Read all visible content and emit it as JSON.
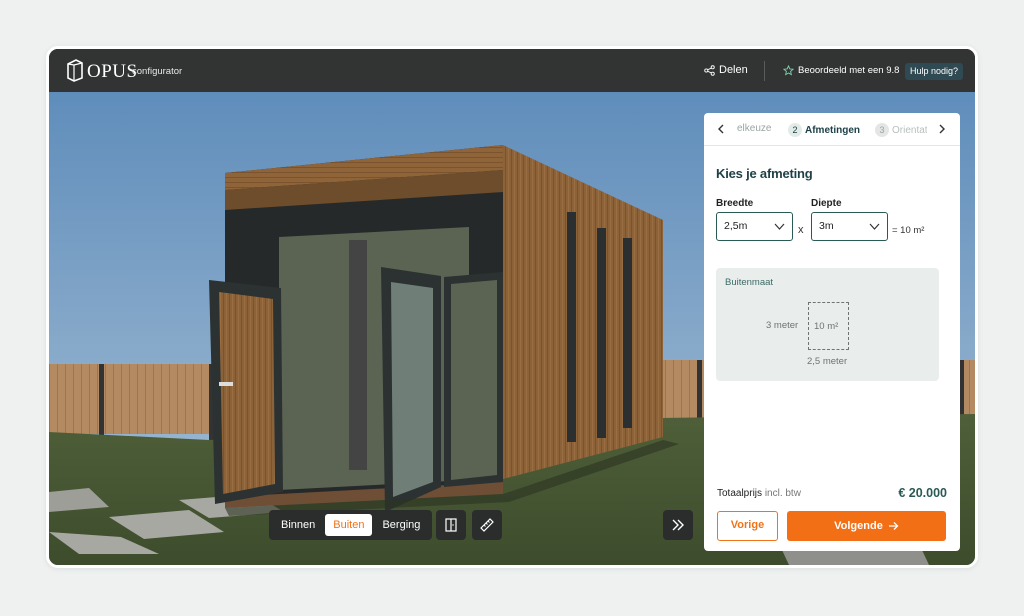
{
  "app": {
    "brand": "OPUS",
    "subtitle": "configurator"
  },
  "topbar": {
    "share_label": "Delen",
    "rating_label": "Beoordeeld met een 9.8",
    "help_label": "Hulp nodig?"
  },
  "viewbar": {
    "options": [
      "Binnen",
      "Buiten",
      "Berging"
    ],
    "selected": "Buiten"
  },
  "steps": {
    "prev": {
      "label": "elkeuze"
    },
    "current": {
      "number": "2",
      "label": "Afmetingen"
    },
    "next": {
      "number": "3",
      "label": "Orientatie"
    }
  },
  "config": {
    "title": "Kies je afmeting",
    "width_label": "Breedte",
    "width_value": "2,5m",
    "depth_label": "Diepte",
    "depth_value": "3m",
    "times": "x",
    "area_result": "= 10 m²",
    "outer": {
      "title": "Buitenmaat",
      "area": "10 m²",
      "depth": "3 meter",
      "width": "2,5 meter"
    }
  },
  "total": {
    "label": "Totaalprijs",
    "sub": "incl. btw",
    "price": "€ 20.000"
  },
  "buttons": {
    "prev": "Vorige",
    "next": "Volgende"
  },
  "colors": {
    "accent": "#f26f16",
    "primary": "#2a5a55",
    "topbar": "#323333"
  }
}
